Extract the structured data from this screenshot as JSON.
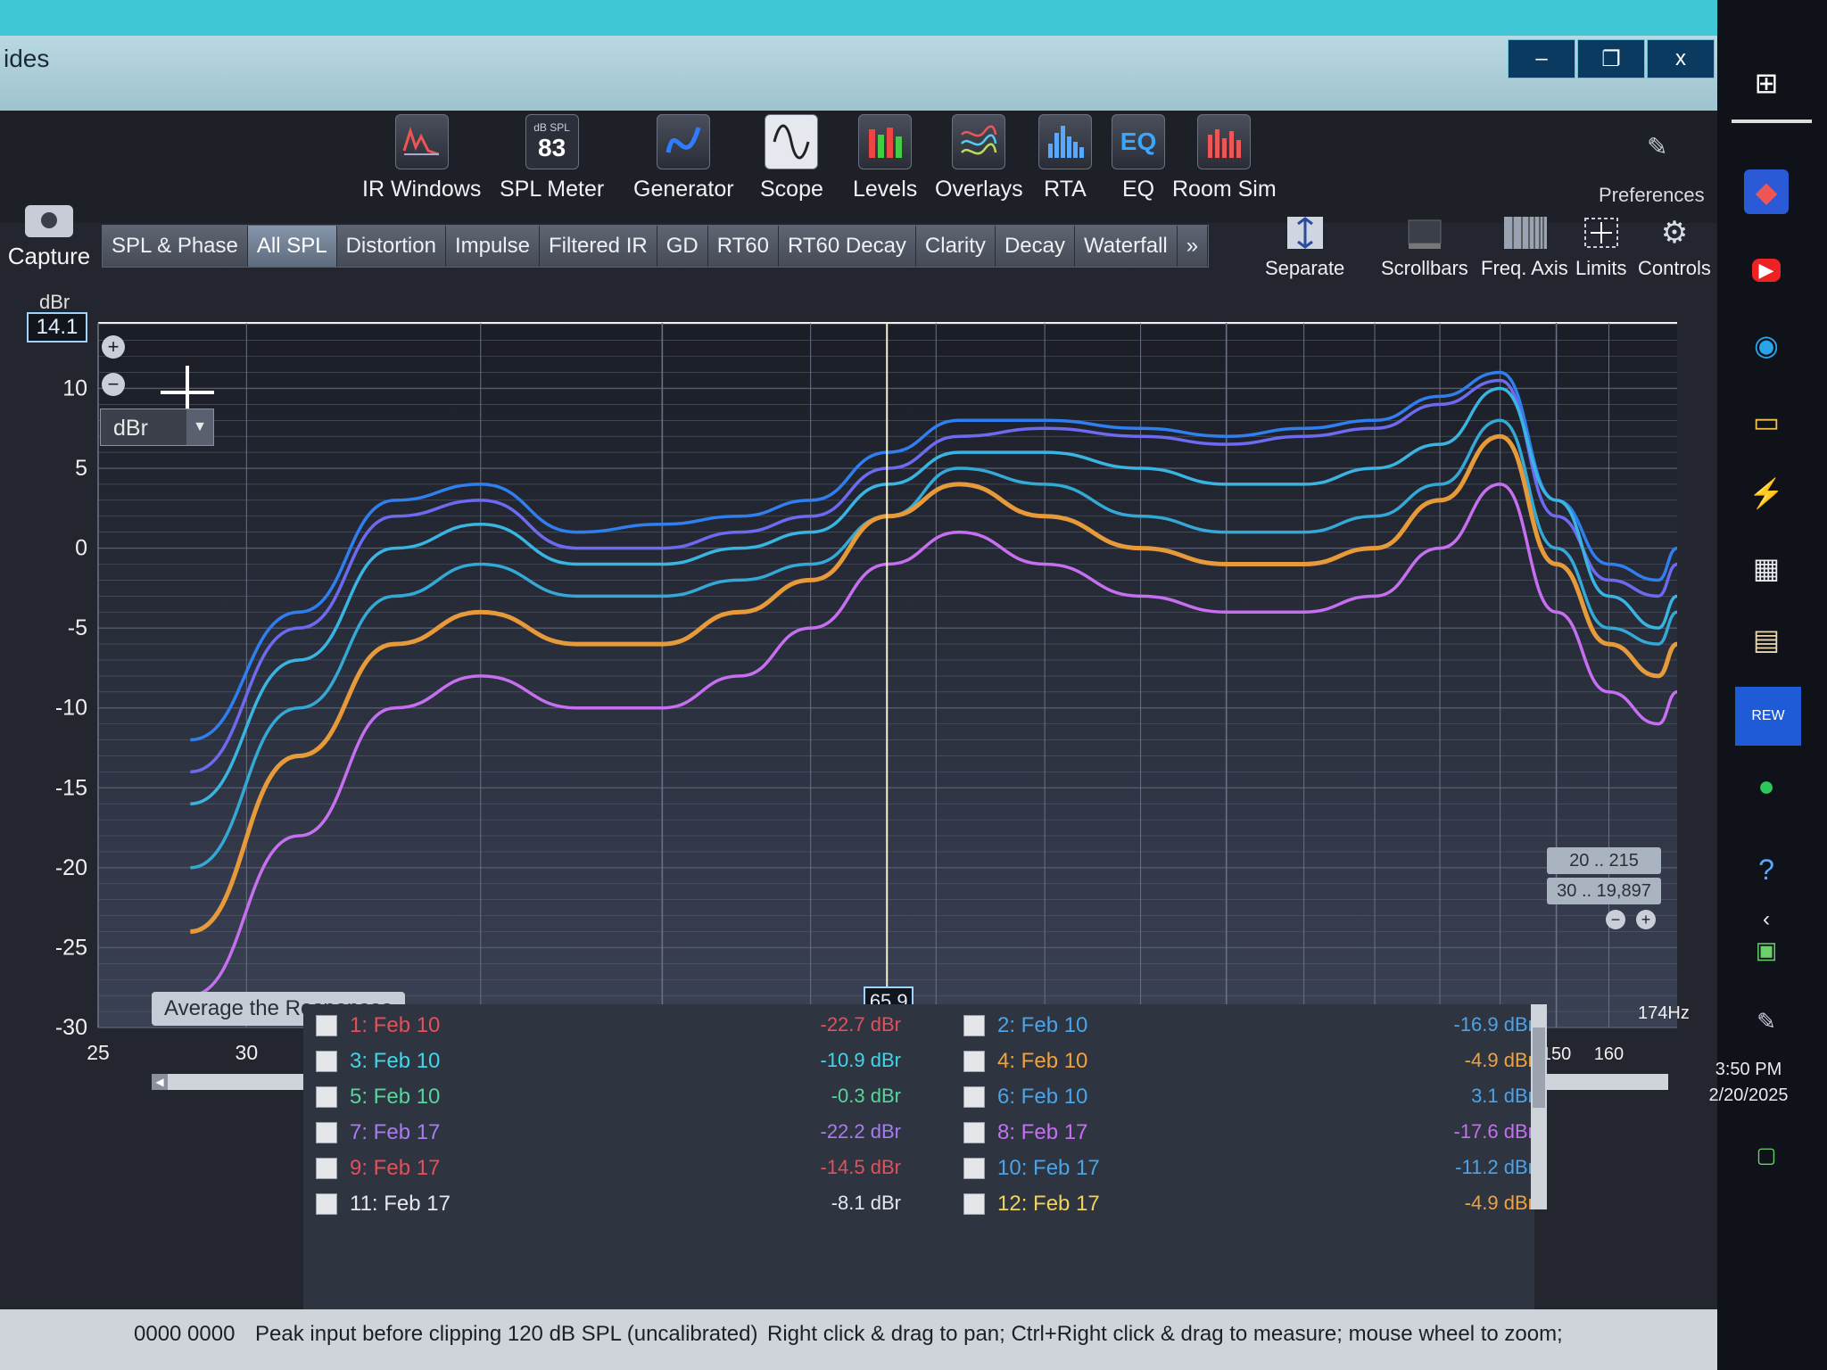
{
  "window": {
    "title": "ides",
    "minimize_label": "–",
    "restore_label": "❐",
    "close_label": "x"
  },
  "toolbar": {
    "tools": [
      {
        "label": "IR Windows",
        "icon": "ir-windows-icon"
      },
      {
        "label": "SPL Meter",
        "icon": "spl-meter-icon",
        "readout_top": "dB SPL",
        "readout": "83"
      },
      {
        "label": "Generator",
        "icon": "generator-icon"
      },
      {
        "label": "Scope",
        "icon": "scope-icon"
      },
      {
        "label": "Levels",
        "icon": "levels-icon"
      },
      {
        "label": "Overlays",
        "icon": "overlays-icon"
      },
      {
        "label": "RTA",
        "icon": "rta-icon"
      },
      {
        "label": "EQ",
        "icon": "eq-icon"
      },
      {
        "label": "Room Sim",
        "icon": "room-sim-icon"
      }
    ],
    "preferences_label": "Preferences",
    "capture_label": "Capture"
  },
  "tabs": [
    {
      "label": "SPL & Phase",
      "active": false
    },
    {
      "label": "All SPL",
      "active": true
    },
    {
      "label": "Distortion",
      "active": false
    },
    {
      "label": "Impulse",
      "active": false
    },
    {
      "label": "Filtered IR",
      "active": false
    },
    {
      "label": "GD",
      "active": false
    },
    {
      "label": "RT60",
      "active": false
    },
    {
      "label": "RT60 Decay",
      "active": false
    },
    {
      "label": "Clarity",
      "active": false
    },
    {
      "label": "Decay",
      "active": false
    },
    {
      "label": "Waterfall",
      "active": false
    },
    {
      "label": "»",
      "active": false
    }
  ],
  "graph_tools": {
    "separate": "Separate",
    "scrollbars": "Scrollbars",
    "freq_axis": "Freq. Axis",
    "limits": "Limits",
    "controls": "Controls"
  },
  "graph": {
    "y_unit_top": "dBr",
    "y_readout": "14.1",
    "unit_selected": "dBr",
    "cursor_x_readout": "65.9",
    "x_unit_label": "174Hz",
    "average_button": "Average the Responses",
    "range_1": "20 .. 215",
    "range_2": "30 .. 19,897"
  },
  "chart_data": {
    "type": "line",
    "xlabel": "",
    "ylabel": "dBr",
    "xlim": [
      25,
      174
    ],
    "ylim": [
      -30,
      14.1
    ],
    "x_scale": "log",
    "grid": true,
    "yticks": [
      10,
      5,
      0,
      -5,
      -10,
      -15,
      -20,
      -25,
      -30
    ],
    "xticks": [
      25,
      30,
      40,
      50,
      60,
      70,
      80,
      90,
      100,
      110,
      120,
      130,
      140,
      150,
      160
    ],
    "cursor_x": 65.9,
    "series": [
      {
        "name": "",
        "color": "#2f7ff0",
        "x": [
          28,
          32,
          36,
          40,
          45,
          50,
          55,
          60,
          66,
          72,
          80,
          90,
          100,
          110,
          120,
          130,
          140,
          150,
          160,
          170,
          174
        ],
        "y": [
          -12,
          -4,
          3,
          4,
          1,
          1.5,
          2,
          3,
          6,
          8,
          8,
          7.5,
          7,
          7.5,
          8,
          9.5,
          11,
          3,
          -1,
          -2,
          0
        ]
      },
      {
        "name": "",
        "color": "#6d6af0",
        "x": [
          28,
          32,
          36,
          40,
          45,
          50,
          55,
          60,
          66,
          72,
          80,
          90,
          100,
          110,
          120,
          130,
          140,
          150,
          160,
          170,
          174
        ],
        "y": [
          -14,
          -5,
          2,
          3,
          0,
          0,
          1,
          2,
          5,
          7,
          7.5,
          7,
          6.5,
          7,
          7.5,
          9,
          10.5,
          2,
          -2,
          -3,
          -1
        ]
      },
      {
        "name": "",
        "color": "#3ab4e0",
        "x": [
          28,
          32,
          36,
          40,
          45,
          50,
          55,
          60,
          66,
          72,
          80,
          90,
          100,
          110,
          120,
          130,
          140,
          150,
          160,
          170,
          174
        ],
        "y": [
          -16,
          -7,
          0,
          1.5,
          -1,
          -1,
          0,
          1,
          4,
          6,
          6,
          5,
          4,
          4,
          5,
          6.5,
          10,
          3,
          -3,
          -5,
          -3
        ]
      },
      {
        "name": "",
        "color": "#34a9d6",
        "x": [
          28,
          32,
          36,
          40,
          45,
          50,
          55,
          60,
          66,
          72,
          80,
          90,
          100,
          110,
          120,
          130,
          140,
          150,
          160,
          170,
          174
        ],
        "y": [
          -20,
          -10,
          -3,
          -1,
          -3,
          -3,
          -2,
          -1,
          2,
          5,
          4,
          2,
          1,
          1,
          2,
          4,
          8,
          0,
          -5,
          -6,
          -4
        ]
      },
      {
        "name": "",
        "color": "#e79a3a",
        "x": [
          28,
          32,
          36,
          40,
          45,
          50,
          55,
          60,
          66,
          72,
          80,
          90,
          100,
          110,
          120,
          130,
          140,
          150,
          160,
          170,
          174
        ],
        "y": [
          -24,
          -13,
          -6,
          -4,
          -6,
          -6,
          -4,
          -2,
          2,
          4,
          2,
          0,
          -1,
          -1,
          0,
          3,
          7,
          -1,
          -6,
          -8,
          -6
        ]
      },
      {
        "name": "",
        "color": "#c66ff0",
        "x": [
          28,
          32,
          36,
          40,
          45,
          50,
          55,
          60,
          66,
          72,
          80,
          90,
          100,
          110,
          120,
          130,
          140,
          150,
          160,
          170,
          174
        ],
        "y": [
          -28,
          -18,
          -10,
          -8,
          -10,
          -10,
          -8,
          -5,
          -1,
          1,
          -1,
          -3,
          -4,
          -4,
          -3,
          0,
          4,
          -4,
          -9,
          -11,
          -9
        ]
      }
    ]
  },
  "legend": {
    "items": [
      {
        "label": "1: Feb 10",
        "value": "-22.7 dBr",
        "label_color": "#e2505a",
        "value_color": "#e2505a",
        "col": 0,
        "row": 0
      },
      {
        "label": "3: Feb 10",
        "value": "-10.9 dBr",
        "label_color": "#3fd7ea",
        "value_color": "#3fd7ea",
        "col": 0,
        "row": 1
      },
      {
        "label": "5: Feb 10",
        "value": "-0.3 dBr",
        "label_color": "#56d69a",
        "value_color": "#56d69a",
        "col": 0,
        "row": 2
      },
      {
        "label": "7: Feb 17",
        "value": "-22.2 dBr",
        "label_color": "#a77cf0",
        "value_color": "#a77cf0",
        "col": 0,
        "row": 3
      },
      {
        "label": "9: Feb 17",
        "value": "-14.5 dBr",
        "label_color": "#e2505a",
        "value_color": "#e2505a",
        "col": 0,
        "row": 4
      },
      {
        "label": "11: Feb 17",
        "value": "-8.1 dBr",
        "label_color": "#e6e8ee",
        "value_color": "#e6e8ee",
        "col": 0,
        "row": 5
      },
      {
        "label": "2: Feb 10",
        "value": "-16.9 dBr",
        "label_color": "#4aa4e8",
        "value_color": "#4aa4e8",
        "col": 1,
        "row": 0
      },
      {
        "label": "4: Feb 10",
        "value": "-4.9 dBr",
        "label_color": "#f0a33a",
        "value_color": "#f0a33a",
        "col": 1,
        "row": 1
      },
      {
        "label": "6: Feb 10",
        "value": "3.1 dBr",
        "label_color": "#4aa4e8",
        "value_color": "#4aa4e8",
        "col": 1,
        "row": 2
      },
      {
        "label": "8: Feb 17",
        "value": "-17.6 dBr",
        "label_color": "#c66ff0",
        "value_color": "#c66ff0",
        "col": 1,
        "row": 3
      },
      {
        "label": "10: Feb 17",
        "value": "-11.2 dBr",
        "label_color": "#4aa4e8",
        "value_color": "#4aa4e8",
        "col": 1,
        "row": 4
      },
      {
        "label": "12: Feb 17",
        "value": "-4.9 dBr",
        "label_color": "#f0d35a",
        "value_color": "#f0a33a",
        "col": 1,
        "row": 5
      }
    ]
  },
  "status": {
    "left": "0000 0000",
    "peak": "Peak input before clipping 120 dB SPL (uncalibrated)",
    "hint": "Right click & drag to pan; Ctrl+Right click & drag to measure; mouse wheel to zoom;"
  },
  "taskbar": {
    "time": "3:50 PM",
    "date": "2/20/2025",
    "rew_label": "REW"
  }
}
